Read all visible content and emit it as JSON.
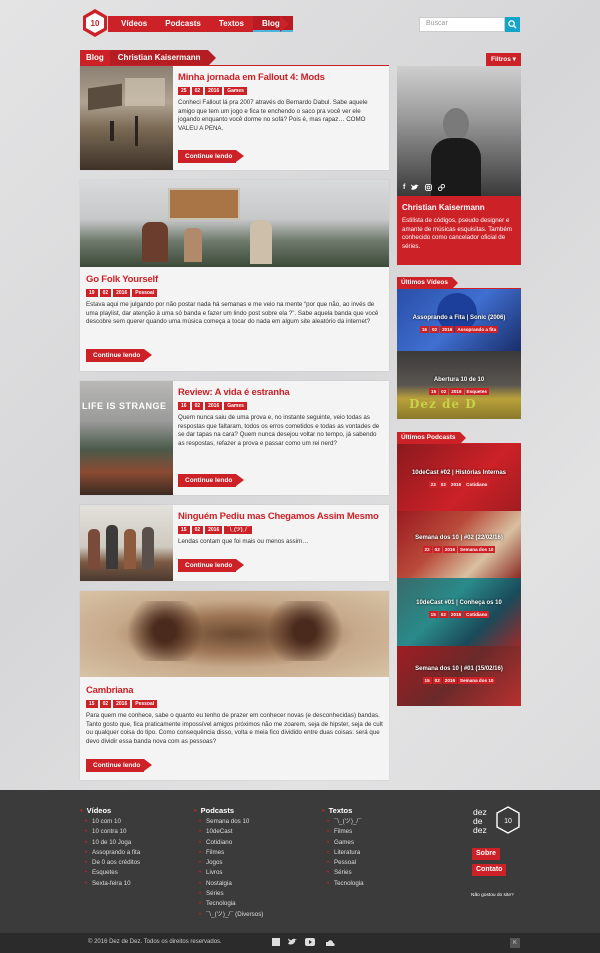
{
  "nav": {
    "items": [
      "Vídeos",
      "Podcasts",
      "Textos",
      "Blogs"
    ],
    "active": "Blogs",
    "logo_text": "10"
  },
  "search": {
    "placeholder": "Buscar"
  },
  "blog_header": {
    "label": "Blog",
    "author": "Christian Kaisermann"
  },
  "filtros": "Filtros ▾",
  "posts": [
    {
      "title": "Minha jornada em Fallout 4: Mods",
      "date": [
        "25",
        "02",
        "2016"
      ],
      "category": "Games",
      "excerpt": "Conheci Fallout lá pra 2007 através do Bernardo Dabul. Sabe aquele amigo que tem um jogo e fica te enchendo o saco pra você ver ele jogando enquanto você dorme no sofá? Pois é, mas rapaz… COMO VALEU A PENA.",
      "button": "Continue lendo"
    },
    {
      "title": "Go Folk Yourself",
      "date": [
        "19",
        "02",
        "2016"
      ],
      "category": "Pessoal",
      "excerpt": "Estava aqui me julgando por não postar nada há semanas e me veio na mente “por que não, ao invés de uma playlist, dar atenção à uma só banda e fazer um lindo post sobre ela ?”. Sabe aquela banda que você descobre sem querer quando uma música começa a tocar do nada em algum site aleatório da internet?",
      "button": "Continue lendo"
    },
    {
      "title": "Review: A vida é estranha",
      "date": [
        "16",
        "02",
        "2016"
      ],
      "category": "Games",
      "excerpt": "Quem nunca saiu de uma prova e, no instante seguinte, veio todas as respostas que faltaram, todos os erros cometidos e todas as vontades de se dar tapas na cara? Quem nunca desejou voltar no tempo, já sabendo as respostas, refazer a prova e passar como um rei nerd?",
      "button": "Continue lendo",
      "image_text": "LIFE IS STRANGE"
    },
    {
      "title": "Ninguém Pediu mas Chegamos Assim Mesmo",
      "date": [
        "15",
        "02",
        "2016"
      ],
      "category": "¯\\_(ツ)_/¯",
      "excerpt": "Lendas contam que foi mais ou menos assim…",
      "button": "Continue lendo"
    },
    {
      "title": "Cambriana",
      "date": [
        "15",
        "02",
        "2016"
      ],
      "category": "Pessoal",
      "excerpt": "Para quem me conhece, sabe o quanto eu tenho de prazer em conhecer novas (e desconhecidas) bandas. Tanto gosto que, fica praticamente impossível amigos próximos não me zoarem, seja de hipster, seja de cult ou qualquer coisa do tipo. Como consequência disso, volta e meia fico dividido entre duas coisas: será que devo dividir essa banda nova com as pessoas?",
      "button": "Continue lendo"
    }
  ],
  "profile": {
    "name": "Christian Kaisermann",
    "bio": "Estilista de códigos, pseudo designer e amante de músicas esquisitas. Também conhecido como cancelador oficial de séries."
  },
  "ultimos_videos": {
    "label": "Últimos Vídeos",
    "items": [
      {
        "title": "Assoprando a Fita | Sonic (2006)",
        "date": [
          "16",
          "02",
          "2016"
        ],
        "category": "Assoprando a fita"
      },
      {
        "title": "Abertura 10 de 10",
        "date": [
          "15",
          "02",
          "2016"
        ],
        "category": "Esquetes",
        "image_text": "Dez de D"
      }
    ]
  },
  "ultimos_podcasts": {
    "label": "Últimos Podcasts",
    "items": [
      {
        "title": "10deCast #02 | Histórias Internas",
        "date": [
          "23",
          "02",
          "2016"
        ],
        "category": "Cotidiano"
      },
      {
        "title": "Semana dos 10 | #02 (22/02/16)",
        "date": [
          "22",
          "02",
          "2016"
        ],
        "category": "Semana dos 10"
      },
      {
        "title": "10deCast #01 | Conheça os 10",
        "date": [
          "15",
          "02",
          "2016"
        ],
        "category": "Cotidiano"
      },
      {
        "title": "Semana dos 10 | #01 (15/02/16)",
        "date": [
          "15",
          "02",
          "2016"
        ],
        "category": "Semana dos 10"
      }
    ]
  },
  "footer": {
    "videos": {
      "title": "Vídeos",
      "items": [
        "10 com 10",
        "10 contra 10",
        "10 de 10 Joga",
        "Assoprando a fita",
        "De 0 aos créditos",
        "Esquetes",
        "Sexta-feira 10"
      ]
    },
    "podcasts": {
      "title": "Podcasts",
      "items": [
        "Semana dos 10",
        "10deCast",
        "Cotidiano",
        "Filmes",
        "Jogos",
        "Livros",
        "Nostalgia",
        "Séries",
        "Tecnologia",
        "¯\\_(ツ)_/¯ (Diversos)"
      ]
    },
    "textos": {
      "title": "Textos",
      "items": [
        "¯\\_(ツ)_/¯",
        "Filmes",
        "Games",
        "Literatura",
        "Pessoal",
        "Séries",
        "Tecnologia"
      ]
    },
    "brand": [
      "dez",
      "de",
      "dez"
    ],
    "brand_logo": "10",
    "sobre": "Sobre",
    "contato": "Contato",
    "tagline": "Não gostou do site?",
    "copyright": "© 2016 Dez de Dez. Todos os direitos reservados.",
    "k_badge": "K"
  },
  "colors": {
    "accent": "#cc2127",
    "search": "#14a5c8",
    "footer": "#3b3b3b"
  }
}
